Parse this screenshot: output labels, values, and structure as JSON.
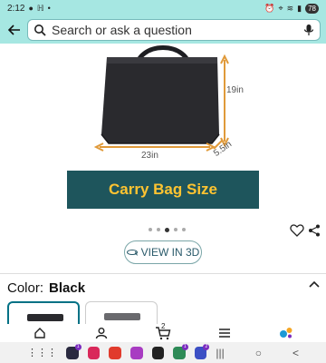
{
  "status_bar": {
    "time": "2:12",
    "battery": "78"
  },
  "search": {
    "placeholder": "Search or ask a question"
  },
  "product_image": {
    "dim_height": "19in",
    "dim_width": "23in",
    "dim_depth": "5.5in",
    "banner_text": "Carry Bag Size"
  },
  "carousel": {
    "dot_count": 5,
    "active_index": 2
  },
  "view3d": {
    "label": "VIEW IN 3D"
  },
  "color": {
    "label": "Color:",
    "value": "Black"
  },
  "colors": {
    "accent": "#007185",
    "banner_bg": "#1e555c",
    "banner_text": "#ffc431",
    "header_bg": "#a6e7e2",
    "dimension_arrow": "#e09a3a"
  },
  "bottom_nav": [
    {
      "name": "home-icon"
    },
    {
      "name": "account-icon"
    },
    {
      "name": "cart-icon",
      "badge": "2"
    },
    {
      "name": "menu-icon"
    },
    {
      "name": "rufus-icon"
    }
  ],
  "system_apps": [
    {
      "name": "app-1-icon",
      "color": "#2a2a40",
      "badge": "1"
    },
    {
      "name": "app-2-icon",
      "color": "#d9285a"
    },
    {
      "name": "app-3-icon",
      "color": "#e13b2c"
    },
    {
      "name": "app-4-icon",
      "color": "#a83cc2"
    },
    {
      "name": "app-5-icon",
      "color": "#222"
    },
    {
      "name": "app-6-icon",
      "color": "#2e8b57",
      "badge": "1"
    },
    {
      "name": "app-7-icon",
      "color": "#3b4fc4",
      "badge": "2"
    }
  ]
}
